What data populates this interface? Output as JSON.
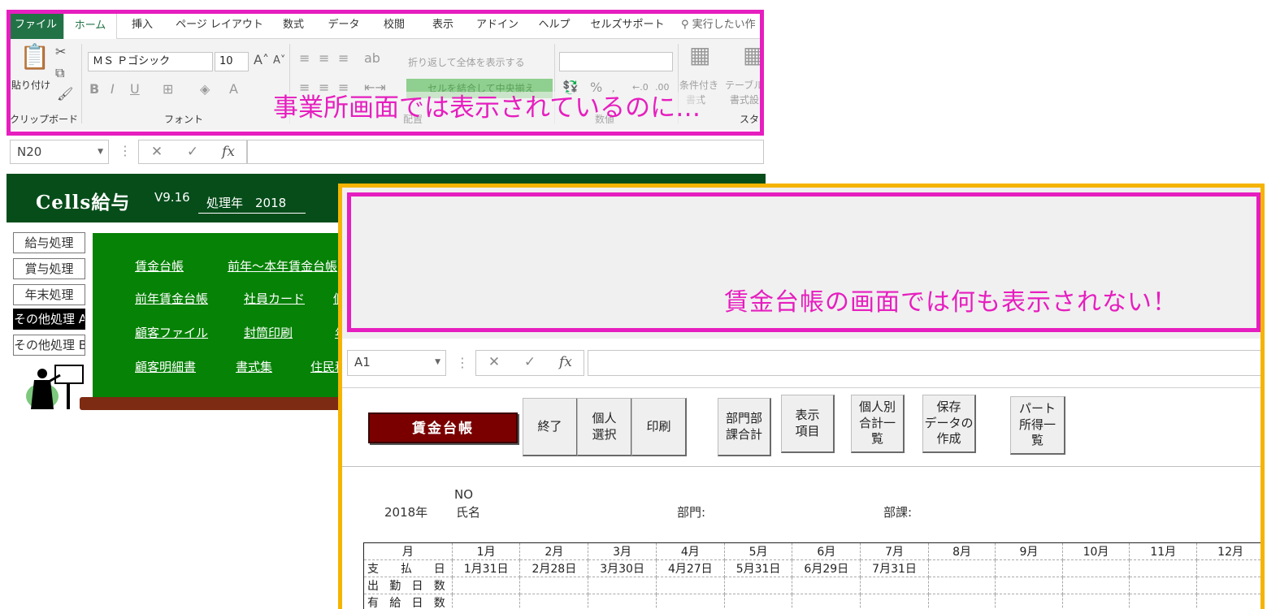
{
  "excel": {
    "tabs": [
      {
        "label": "ファイル",
        "active": false,
        "file": true
      },
      {
        "label": "ホーム",
        "active": true,
        "file": false
      },
      {
        "label": "挿入",
        "active": false,
        "file": false
      },
      {
        "label": "ページ レイアウト",
        "active": false,
        "file": false
      },
      {
        "label": "数式",
        "active": false,
        "file": false
      },
      {
        "label": "データ",
        "active": false,
        "file": false
      },
      {
        "label": "校閲",
        "active": false,
        "file": false
      },
      {
        "label": "表示",
        "active": false,
        "file": false
      },
      {
        "label": "アドイン",
        "active": false,
        "file": false
      },
      {
        "label": "ヘルプ",
        "active": false,
        "file": false
      },
      {
        "label": "セルズサポート",
        "active": false,
        "file": false
      }
    ],
    "search_placeholder": "実行したい作",
    "ribbon": {
      "paste_label": "貼り付け",
      "clipboard_group": "クリップボード",
      "font_name": "ＭＳ Ｐゴシック",
      "font_size": "10",
      "font_group": "フォント",
      "wrap_text": "折り返して全体を表示する",
      "merge_center": "セルを結合して中央揃え",
      "alignment_group": "配置",
      "number_group": "数値",
      "conditional_format": "条件付き",
      "conditional_format_2": "書式",
      "table_format": "テーブル",
      "table_format_2": "書式設",
      "styles_group": "スタ"
    },
    "name_box": "N20",
    "fx": "fx"
  },
  "callouts": {
    "top": "事業所画面では表示されているのに…",
    "front": "賃金台帳の画面では何も表示されない！"
  },
  "cells_app": {
    "title": "Cells給与",
    "version": "V9.16",
    "year_label": "処理年　2018",
    "side_menu": [
      {
        "label": "給与処理",
        "selected": false
      },
      {
        "label": "賞与処理",
        "selected": false
      },
      {
        "label": "年末処理",
        "selected": false
      },
      {
        "label": "その他処理 A",
        "selected": true
      },
      {
        "label": "その他処理 B",
        "selected": false
      }
    ],
    "links": [
      "賃金台帳",
      "前年～本年賃金台帳",
      "前年賃金台帳",
      "社員カード",
      "個",
      "顧客ファイル",
      "封筒印刷",
      "年",
      "顧客明細書",
      "書式集",
      "住民税"
    ]
  },
  "ledger_window": {
    "name_box": "A1",
    "fx": "fx",
    "title_button": "賃金台帳",
    "buttons": [
      {
        "label": "終了"
      },
      {
        "label": "個人\n選択"
      },
      {
        "label": "印刷"
      },
      {
        "label": "部門部\n課合計"
      },
      {
        "label": "表示\n項目"
      },
      {
        "label": "個人別\n合計一\n覧"
      },
      {
        "label": "保存\nデータの\n作成"
      },
      {
        "label": "パート\n所得一\n覧"
      }
    ],
    "info": {
      "no_label": "NO",
      "year": "2018年",
      "name_label": "氏名",
      "dept_label": "部門:",
      "section_label": "部課:"
    },
    "table": {
      "month_header": "月",
      "months": [
        "1月",
        "2月",
        "3月",
        "4月",
        "5月",
        "6月",
        "7月",
        "8月",
        "9月",
        "10月",
        "11月",
        "12月"
      ],
      "rows": [
        {
          "label": "支払日",
          "values": [
            "1月31日",
            "2月28日",
            "3月30日",
            "4月27日",
            "5月31日",
            "6月29日",
            "7月31日",
            "",
            "",
            "",
            "",
            ""
          ]
        },
        {
          "label": "出勤日数",
          "values": [
            "",
            "",
            "",
            "",
            "",
            "",
            "",
            "",
            "",
            "",
            "",
            ""
          ]
        },
        {
          "label": "有給日数",
          "values": [
            "",
            "",
            "",
            "",
            "",
            "",
            "",
            "",
            "",
            "",
            "",
            ""
          ]
        }
      ]
    }
  }
}
